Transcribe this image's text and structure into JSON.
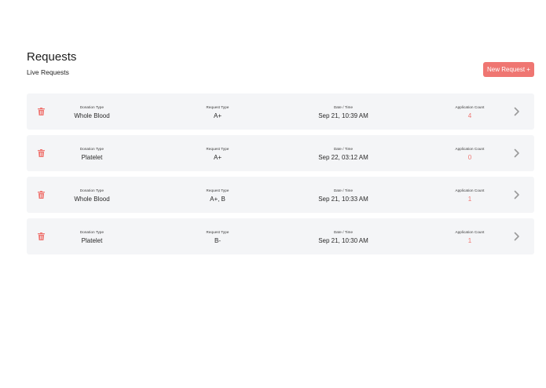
{
  "header": {
    "title": "Requests",
    "subtitle": "Live Requests",
    "new_request_label": "New Request +"
  },
  "colors": {
    "accent": "#ef7672",
    "row_background": "#f4f5f7",
    "chevron": "#9a9a9a"
  },
  "icons": {
    "delete": "trash-icon",
    "open": "chevron-right-icon"
  },
  "column_labels": {
    "donation_type": "Donation Type",
    "request_type": "Request Type",
    "date_time": "Date / Time",
    "application_count": "Application Count"
  },
  "requests": [
    {
      "donation_type": "Whole Blood",
      "request_type": "A+",
      "date_time": "Sep 21, 10:39 AM",
      "application_count": "4"
    },
    {
      "donation_type": "Platelet",
      "request_type": "A+",
      "date_time": "Sep 22, 03:12 AM",
      "application_count": "0"
    },
    {
      "donation_type": "Whole Blood",
      "request_type": "A+, B",
      "date_time": "Sep 21, 10:33 AM",
      "application_count": "1"
    },
    {
      "donation_type": "Platelet",
      "request_type": "B-",
      "date_time": "Sep 21, 10:30 AM",
      "application_count": "1"
    }
  ]
}
